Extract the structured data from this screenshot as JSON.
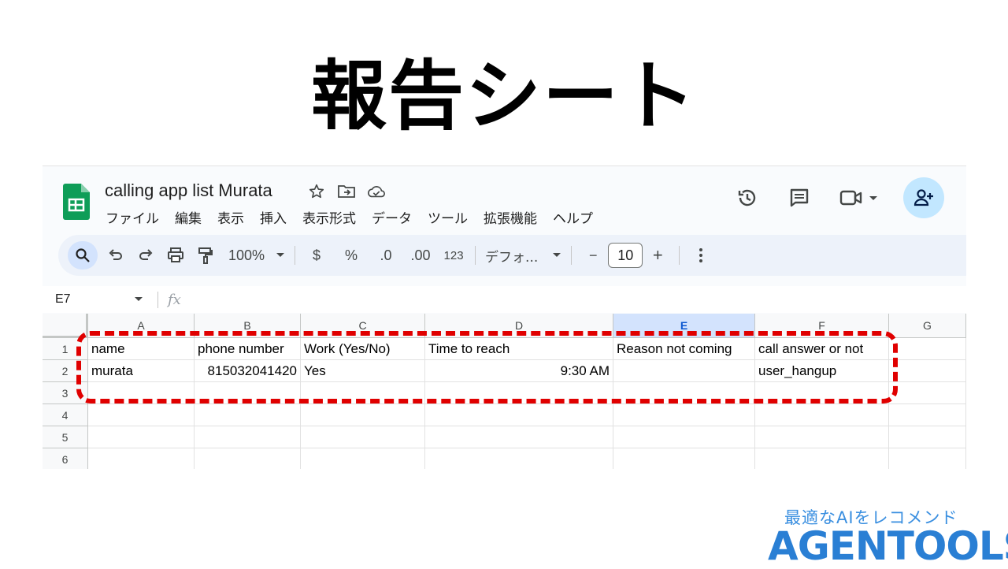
{
  "slide": {
    "title": "報告シート"
  },
  "app": {
    "doc_title": "calling app list Murata",
    "menu": [
      "ファイル",
      "編集",
      "表示",
      "挿入",
      "表示形式",
      "データ",
      "ツール",
      "拡張機能",
      "ヘルプ"
    ]
  },
  "toolbar": {
    "zoom": "100%",
    "currency": "$",
    "percent": "%",
    "dec_decrease": ".0",
    "dec_increase": ".00",
    "number_format": "123",
    "font": "デフォ...",
    "font_size": "10",
    "minus": "−",
    "plus": "+"
  },
  "formula_bar": {
    "cell_ref": "E7",
    "fx": "fx"
  },
  "grid": {
    "columns": [
      "A",
      "B",
      "C",
      "D",
      "E",
      "F",
      "G"
    ],
    "rows": [
      "1",
      "2",
      "3",
      "4",
      "5",
      "6"
    ],
    "selected_column": "E",
    "row1": [
      "name",
      "phone number",
      "Work (Yes/No)",
      "Time to reach",
      "Reason not coming",
      "call answer or not"
    ],
    "row2": [
      "murata",
      "815032041420",
      "Yes",
      "9:30 AM",
      "",
      "user_hangup"
    ]
  },
  "brand": {
    "tagline": "最適なAIをレコメンド",
    "logo": "AGENTOOLS",
    "colors": {
      "primary": "#2a7fd4",
      "accent": "#e00000"
    }
  }
}
